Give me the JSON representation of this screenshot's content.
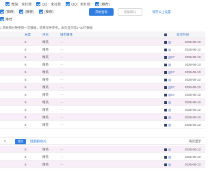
{
  "filters": {
    "row1": [
      {
        "label": "微信：未打款"
      },
      {
        "label": "QQ：未打款"
      },
      {
        "label": "QQ：未打款"
      },
      {
        "label": "(推荐)"
      }
    ],
    "row2": [
      {
        "label": "(推荐)"
      },
      {
        "label": "(推荐)"
      },
      {
        "label": "(推荐)"
      },
      {
        "label": "(推荐)"
      }
    ],
    "row3": [
      {
        "label": "推荐 "
      }
    ]
  },
  "actions": {
    "search": "开始查询",
    "reset": "恢复默认",
    "save": "保存以上设置"
  },
  "notice": "1 系统每分钟更新一次数据，结果仅供参考。本页显示前1~30行数据",
  "table": {
    "columns": [
      "长度",
      "评论",
      "城市属性",
      "",
      "首次时间"
    ],
    "rows": [
      {
        "len": "5",
        "status": "精英",
        "attr": "—",
        "mark": "",
        "date": "2026-06-13",
        "alt": true
      },
      {
        "len": "5",
        "status": "精英",
        "attr": "—",
        "mark": "",
        "date": "2026-06-13",
        "alt": false
      },
      {
        "len": "5",
        "status": "精英",
        "attr": "—",
        "mark": "57",
        "date": "2026-06-13",
        "alt": true
      },
      {
        "len": "5",
        "status": "精英",
        "attr": "—",
        "mark": "",
        "date": "2026-06-13",
        "alt": false
      },
      {
        "len": "5",
        "status": "精英",
        "attr": "—",
        "mark": "57",
        "date": "2026-06-13",
        "alt": true
      },
      {
        "len": "5",
        "status": "精英",
        "attr": "—",
        "mark": "",
        "date": "2026-06-13",
        "alt": false
      },
      {
        "len": "5",
        "status": "精英",
        "attr": "—",
        "mark": "57",
        "date": "2026-06-13",
        "alt": true
      },
      {
        "len": "5",
        "status": "精英",
        "attr": "—",
        "mark": "57",
        "date": "2026-06-13",
        "alt": false
      },
      {
        "len": "5",
        "status": "精英",
        "attr": "—",
        "mark": "",
        "date": "2026-06-13",
        "alt": true
      },
      {
        "len": "5",
        "status": "精英",
        "attr": "—",
        "mark": "",
        "date": "2026-06-13",
        "alt": false
      },
      {
        "len": "5",
        "status": "精英",
        "attr": "—",
        "mark": "",
        "date": "2026-06-13",
        "alt": true
      },
      {
        "len": "5",
        "status": "精英",
        "attr": "—",
        "mark": "",
        "date": "2026-06-13",
        "alt": false
      }
    ]
  },
  "toolbar": {
    "count": "2",
    "button": "提交",
    "link": "批量删除(0)",
    "right": "每页显示"
  },
  "bottom_rows": [
    {
      "len": "5",
      "status": "精英",
      "attr": "—",
      "date": "2026-06-13",
      "alt": true
    },
    {
      "len": "5",
      "status": "精英",
      "attr": "—",
      "date": "2026-06-13",
      "alt": false
    },
    {
      "len": "5",
      "status": "精英",
      "attr": "—",
      "date": "2026-06-13",
      "alt": true
    }
  ]
}
